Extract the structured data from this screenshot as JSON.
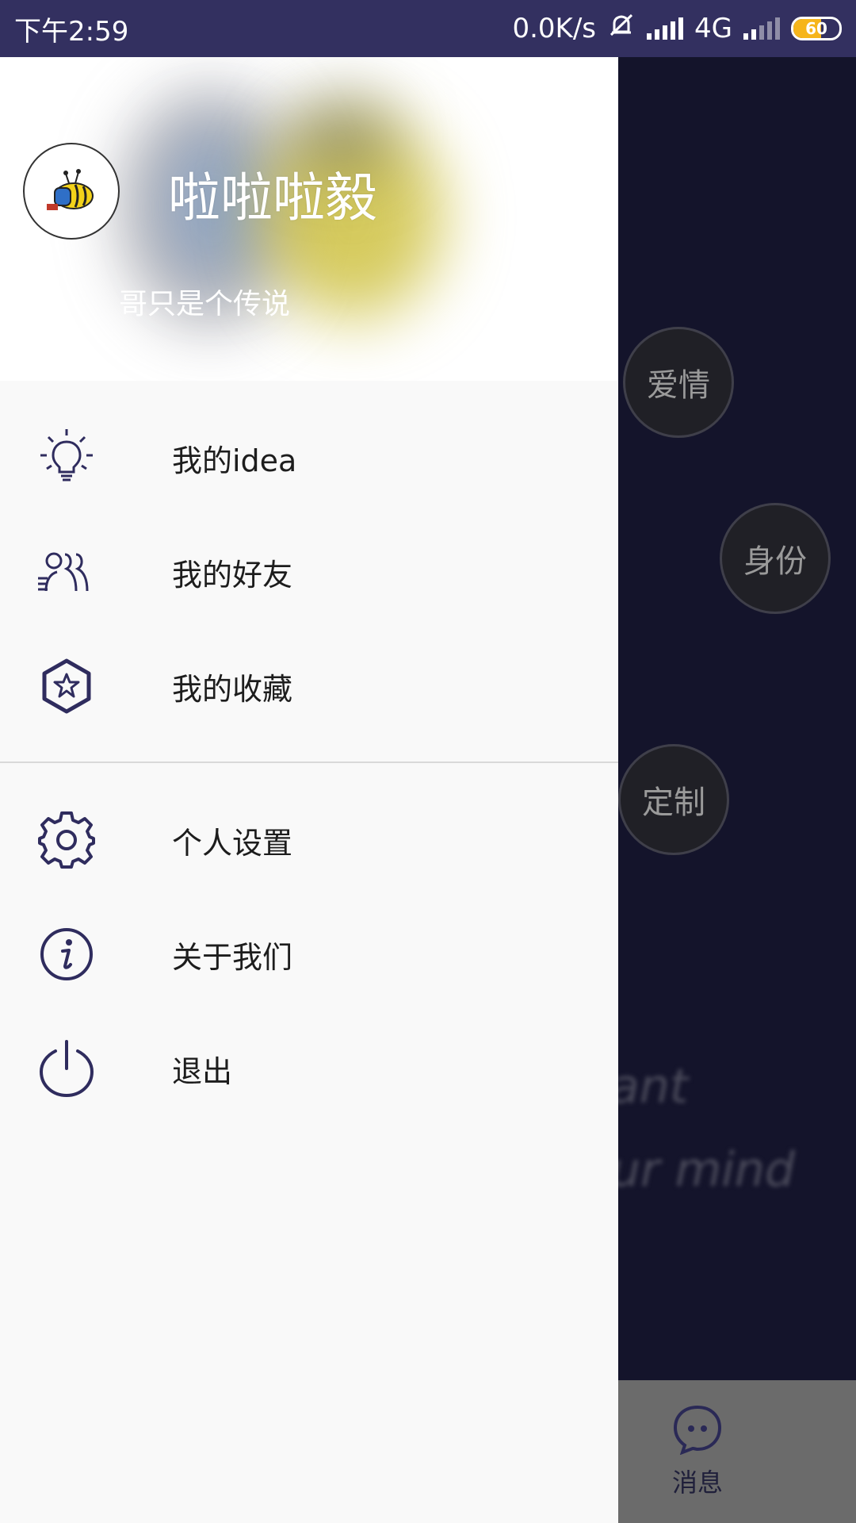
{
  "status_bar": {
    "time": "下午2:59",
    "net_speed": "0.0K/s",
    "network": "4G",
    "battery": "60",
    "battery_level": 0.6
  },
  "drawer": {
    "header": {
      "username": "啦啦啦毅",
      "signature": "哥只是个传说"
    },
    "menu_primary": [
      {
        "icon": "lightbulb-icon",
        "label": "我的idea"
      },
      {
        "icon": "friends-icon",
        "label": "我的好友"
      },
      {
        "icon": "star-hexagon-icon",
        "label": "我的收藏"
      }
    ],
    "menu_secondary": [
      {
        "icon": "gear-icon",
        "label": "个人设置"
      },
      {
        "icon": "info-icon",
        "label": "关于我们"
      },
      {
        "icon": "power-icon",
        "label": "退出"
      }
    ]
  },
  "background": {
    "bubbles": [
      "爱情",
      "身份",
      "定制"
    ],
    "blur_lines": [
      "ant",
      "ur mind"
    ],
    "bottom_nav": {
      "message_label": "消息"
    }
  },
  "colors": {
    "status_bar": "#333060",
    "background": "#14142b",
    "drawer": "#f9f9f9",
    "icon": "#2f2c5e",
    "battery": "#f6b51b"
  }
}
